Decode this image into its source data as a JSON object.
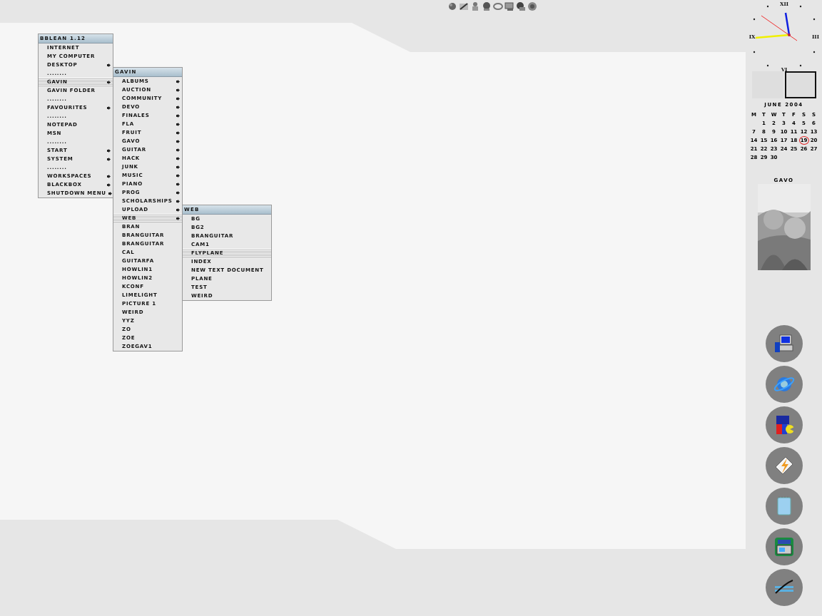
{
  "menus": [
    {
      "title": "BBLEAN 1.12",
      "items": [
        {
          "label": "INTERNET",
          "submenu": false,
          "selected": false
        },
        {
          "label": "MY COMPUTER",
          "submenu": false,
          "selected": false
        },
        {
          "label": "DESKTOP",
          "submenu": true,
          "selected": false
        },
        {
          "label": "........",
          "submenu": false,
          "selected": false
        },
        {
          "label": "GAVIN",
          "submenu": true,
          "selected": true
        },
        {
          "label": "GAVIN FOLDER",
          "submenu": false,
          "selected": false
        },
        {
          "label": "........",
          "submenu": false,
          "selected": false
        },
        {
          "label": "FAVOURITES",
          "submenu": true,
          "selected": false
        },
        {
          "label": "........",
          "submenu": false,
          "selected": false
        },
        {
          "label": "NOTEPAD",
          "submenu": false,
          "selected": false
        },
        {
          "label": "MSN",
          "submenu": false,
          "selected": false
        },
        {
          "label": "........",
          "submenu": false,
          "selected": false
        },
        {
          "label": "START",
          "submenu": true,
          "selected": false
        },
        {
          "label": "SYSTEM",
          "submenu": true,
          "selected": false
        },
        {
          "label": "........",
          "submenu": false,
          "selected": false
        },
        {
          "label": "WORKSPACES",
          "submenu": true,
          "selected": false
        },
        {
          "label": "BLACKBOX",
          "submenu": true,
          "selected": false
        },
        {
          "label": "SHUTDOWN MENU",
          "submenu": true,
          "selected": false
        }
      ]
    },
    {
      "title": "GAVIN",
      "items": [
        {
          "label": "ALBUMS",
          "submenu": true,
          "selected": false
        },
        {
          "label": "AUCTION",
          "submenu": true,
          "selected": false
        },
        {
          "label": "COMMUNITY",
          "submenu": true,
          "selected": false
        },
        {
          "label": "DEVO",
          "submenu": true,
          "selected": false
        },
        {
          "label": "FINALES",
          "submenu": true,
          "selected": false
        },
        {
          "label": "FLA",
          "submenu": true,
          "selected": false
        },
        {
          "label": "FRUIT",
          "submenu": true,
          "selected": false
        },
        {
          "label": "GAVO",
          "submenu": true,
          "selected": false
        },
        {
          "label": "GUITAR",
          "submenu": true,
          "selected": false
        },
        {
          "label": "HACK",
          "submenu": true,
          "selected": false
        },
        {
          "label": "JUNK",
          "submenu": true,
          "selected": false
        },
        {
          "label": "MUSIC",
          "submenu": true,
          "selected": false
        },
        {
          "label": "PIANO",
          "submenu": true,
          "selected": false
        },
        {
          "label": "PROG",
          "submenu": true,
          "selected": false
        },
        {
          "label": "SCHOLARSHIPS",
          "submenu": true,
          "selected": false
        },
        {
          "label": "UPLOAD",
          "submenu": true,
          "selected": false
        },
        {
          "label": "WEB",
          "submenu": true,
          "selected": true
        },
        {
          "label": "BRAN",
          "submenu": false,
          "selected": false
        },
        {
          "label": "BRANGUITAR",
          "submenu": false,
          "selected": false
        },
        {
          "label": "BRANGUITAR",
          "submenu": false,
          "selected": false
        },
        {
          "label": "CAL",
          "submenu": false,
          "selected": false
        },
        {
          "label": "GUITARFA",
          "submenu": false,
          "selected": false
        },
        {
          "label": "HOWLIN1",
          "submenu": false,
          "selected": false
        },
        {
          "label": "HOWLIN2",
          "submenu": false,
          "selected": false
        },
        {
          "label": "KCONF",
          "submenu": false,
          "selected": false
        },
        {
          "label": "LIMELIGHT",
          "submenu": false,
          "selected": false
        },
        {
          "label": "PICTURE 1",
          "submenu": false,
          "selected": false
        },
        {
          "label": "WEIRD",
          "submenu": false,
          "selected": false
        },
        {
          "label": "YYZ",
          "submenu": false,
          "selected": false
        },
        {
          "label": "ZO",
          "submenu": false,
          "selected": false
        },
        {
          "label": "ZOE",
          "submenu": false,
          "selected": false
        },
        {
          "label": "ZOEGAV1",
          "submenu": false,
          "selected": false
        }
      ]
    },
    {
      "title": "WEB",
      "items": [
        {
          "label": "BG",
          "submenu": false,
          "selected": false
        },
        {
          "label": "BG2",
          "submenu": false,
          "selected": false
        },
        {
          "label": "BRANGUITAR",
          "submenu": false,
          "selected": false
        },
        {
          "label": "CAM1",
          "submenu": false,
          "selected": false
        },
        {
          "label": "FLYPLANE",
          "submenu": false,
          "selected": true
        },
        {
          "label": "INDEX",
          "submenu": false,
          "selected": false
        },
        {
          "label": "NEW TEXT DOCUMENT",
          "submenu": false,
          "selected": false
        },
        {
          "label": "PLANE",
          "submenu": false,
          "selected": false
        },
        {
          "label": "TEST",
          "submenu": false,
          "selected": false
        },
        {
          "label": "WEIRD",
          "submenu": false,
          "selected": false
        }
      ]
    }
  ],
  "clock": {
    "numerals": [
      "XII",
      "III",
      "VI",
      "IX"
    ]
  },
  "workspaces": [
    {
      "selected": false
    },
    {
      "selected": true
    }
  ],
  "calendar": {
    "title": "JUNE 2004",
    "weekdays": [
      "M",
      "T",
      "W",
      "T",
      "F",
      "S",
      "S"
    ],
    "weeks": [
      [
        {
          "label": "1",
          "today": false
        },
        {
          "label": "2",
          "today": false
        },
        {
          "label": "3",
          "today": false
        },
        {
          "label": "4",
          "today": false
        },
        {
          "label": "5",
          "today": false
        },
        {
          "label": "6",
          "today": false
        }
      ],
      [
        {
          "label": "7",
          "today": false
        },
        {
          "label": "8",
          "today": false
        },
        {
          "label": "9",
          "today": false
        },
        {
          "label": "10",
          "today": false
        },
        {
          "label": "11",
          "today": false
        },
        {
          "label": "12",
          "today": false
        },
        {
          "label": "13",
          "today": false
        }
      ],
      [
        {
          "label": "14",
          "today": false
        },
        {
          "label": "15",
          "today": false
        },
        {
          "label": "16",
          "today": false
        },
        {
          "label": "17",
          "today": false
        },
        {
          "label": "18",
          "today": false
        },
        {
          "label": "19",
          "today": true
        },
        {
          "label": "20",
          "today": false
        }
      ],
      [
        {
          "label": "21",
          "today": false
        },
        {
          "label": "22",
          "today": false
        },
        {
          "label": "23",
          "today": false
        },
        {
          "label": "24",
          "today": false
        },
        {
          "label": "25",
          "today": false
        },
        {
          "label": "26",
          "today": false
        },
        {
          "label": "27",
          "today": false
        }
      ],
      [
        {
          "label": "28",
          "today": false
        },
        {
          "label": "29",
          "today": false
        },
        {
          "label": "30",
          "today": false
        }
      ]
    ]
  },
  "photo": {
    "caption": "GAVO",
    "kind": "picture"
  }
}
